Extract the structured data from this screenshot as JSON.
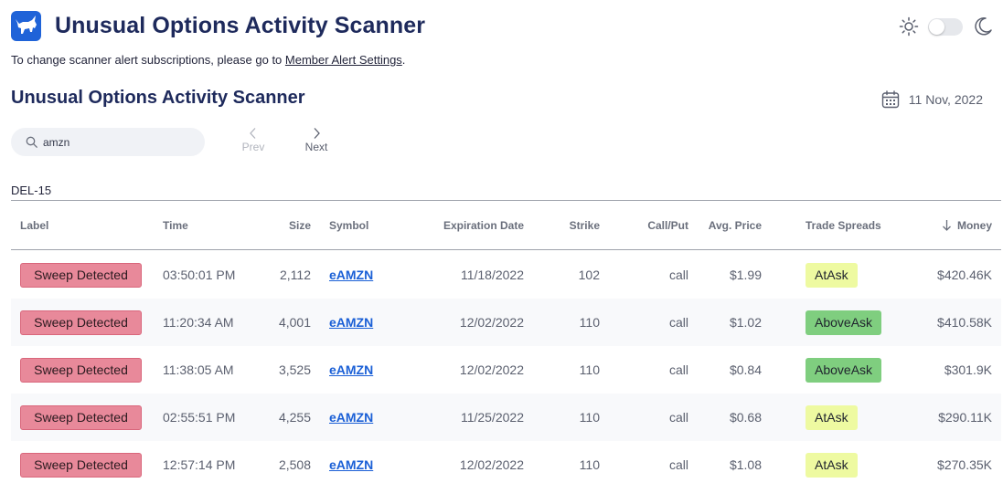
{
  "header": {
    "title": "Unusual Options Activity Scanner",
    "logo_icon": "bull-icon",
    "theme_icons": [
      "sun-icon",
      "toggle-switch",
      "moon-icon"
    ]
  },
  "notice": {
    "text": "To change scanner alert subscriptions, please go to ",
    "link_label": "Member Alert Settings",
    "suffix": "."
  },
  "scanner": {
    "title": "Unusual Options Activity Scanner",
    "date": "11 Nov, 2022",
    "search_value": "amzn",
    "prev_label": "Prev",
    "next_label": "Next",
    "group_label": "DEL-15"
  },
  "table": {
    "columns": [
      "Label",
      "Time",
      "Size",
      "Symbol",
      "Expiration Date",
      "Strike",
      "Call/Put",
      "Avg. Price",
      "Trade Spreads",
      "Money"
    ],
    "sort_column": "Money",
    "rows": [
      {
        "label": "Sweep Detected",
        "time": "03:50:01 PM",
        "size": "2,112",
        "symbol": "eAMZN",
        "expiration": "11/18/2022",
        "strike": "102",
        "callput": "call",
        "price": "$1.99",
        "spread": "AtAsk",
        "money": "$420.46K"
      },
      {
        "label": "Sweep Detected",
        "time": "11:20:34 AM",
        "size": "4,001",
        "symbol": "eAMZN",
        "expiration": "12/02/2022",
        "strike": "110",
        "callput": "call",
        "price": "$1.02",
        "spread": "AboveAsk",
        "money": "$410.58K"
      },
      {
        "label": "Sweep Detected",
        "time": "11:38:05 AM",
        "size": "3,525",
        "symbol": "eAMZN",
        "expiration": "12/02/2022",
        "strike": "110",
        "callput": "call",
        "price": "$0.84",
        "spread": "AboveAsk",
        "money": "$301.9K"
      },
      {
        "label": "Sweep Detected",
        "time": "02:55:51 PM",
        "size": "4,255",
        "symbol": "eAMZN",
        "expiration": "11/25/2022",
        "strike": "110",
        "callput": "call",
        "price": "$0.68",
        "spread": "AtAsk",
        "money": "$290.11K"
      },
      {
        "label": "Sweep Detected",
        "time": "12:57:14 PM",
        "size": "2,508",
        "symbol": "eAMZN",
        "expiration": "12/02/2022",
        "strike": "110",
        "callput": "call",
        "price": "$1.08",
        "spread": "AtAsk",
        "money": "$270.35K"
      }
    ]
  },
  "colors": {
    "brand": "#1f63d8",
    "title": "#1e2a5c",
    "sweep_badge": "#e8899a",
    "at_ask": "#eefaa1",
    "above_ask": "#7fce7f",
    "link": "#1a5fd6"
  }
}
